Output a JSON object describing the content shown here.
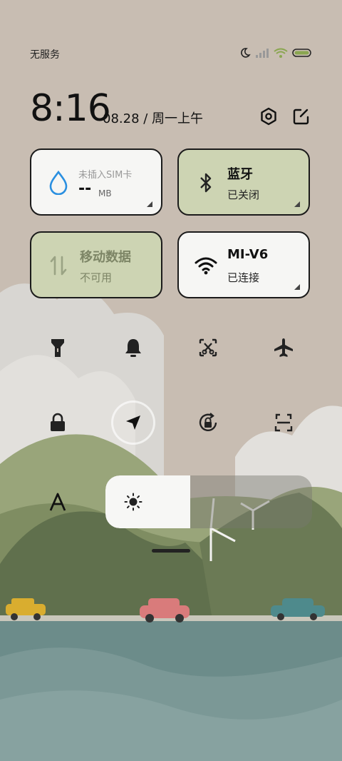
{
  "status_bar": {
    "carrier": "无服务",
    "icons": [
      "moon-icon",
      "signal-icon",
      "wifi-icon",
      "battery-icon"
    ]
  },
  "header": {
    "time": "8:16",
    "date": "08.28 / 周一上午",
    "icons": [
      "settings-icon",
      "edit-icon"
    ]
  },
  "tiles": {
    "data": {
      "title": "未插入SIM卡",
      "value": "--",
      "unit": "MB",
      "icon": "drop-icon"
    },
    "bluetooth": {
      "title": "蓝牙",
      "status": "已关闭",
      "icon": "bluetooth-icon"
    },
    "mobile_data": {
      "title": "移动数据",
      "status": "不可用",
      "icon": "data-arrows-icon"
    },
    "wifi": {
      "title": "MI-V6",
      "status": "已连接",
      "icon": "wifi-icon"
    }
  },
  "toggles": [
    "flashlight-icon",
    "bell-icon",
    "screenshot-icon",
    "airplane-icon",
    "lock-icon",
    "location-icon",
    "rotation-lock-icon",
    "scan-icon",
    "font-size-icon"
  ],
  "brightness": {
    "level": 0.41,
    "icon": "sun-icon"
  },
  "colors": {
    "accent_blue": "#2a8fe0",
    "tile_green": "#cdd4b3",
    "tile_white": "#f6f6f4"
  }
}
